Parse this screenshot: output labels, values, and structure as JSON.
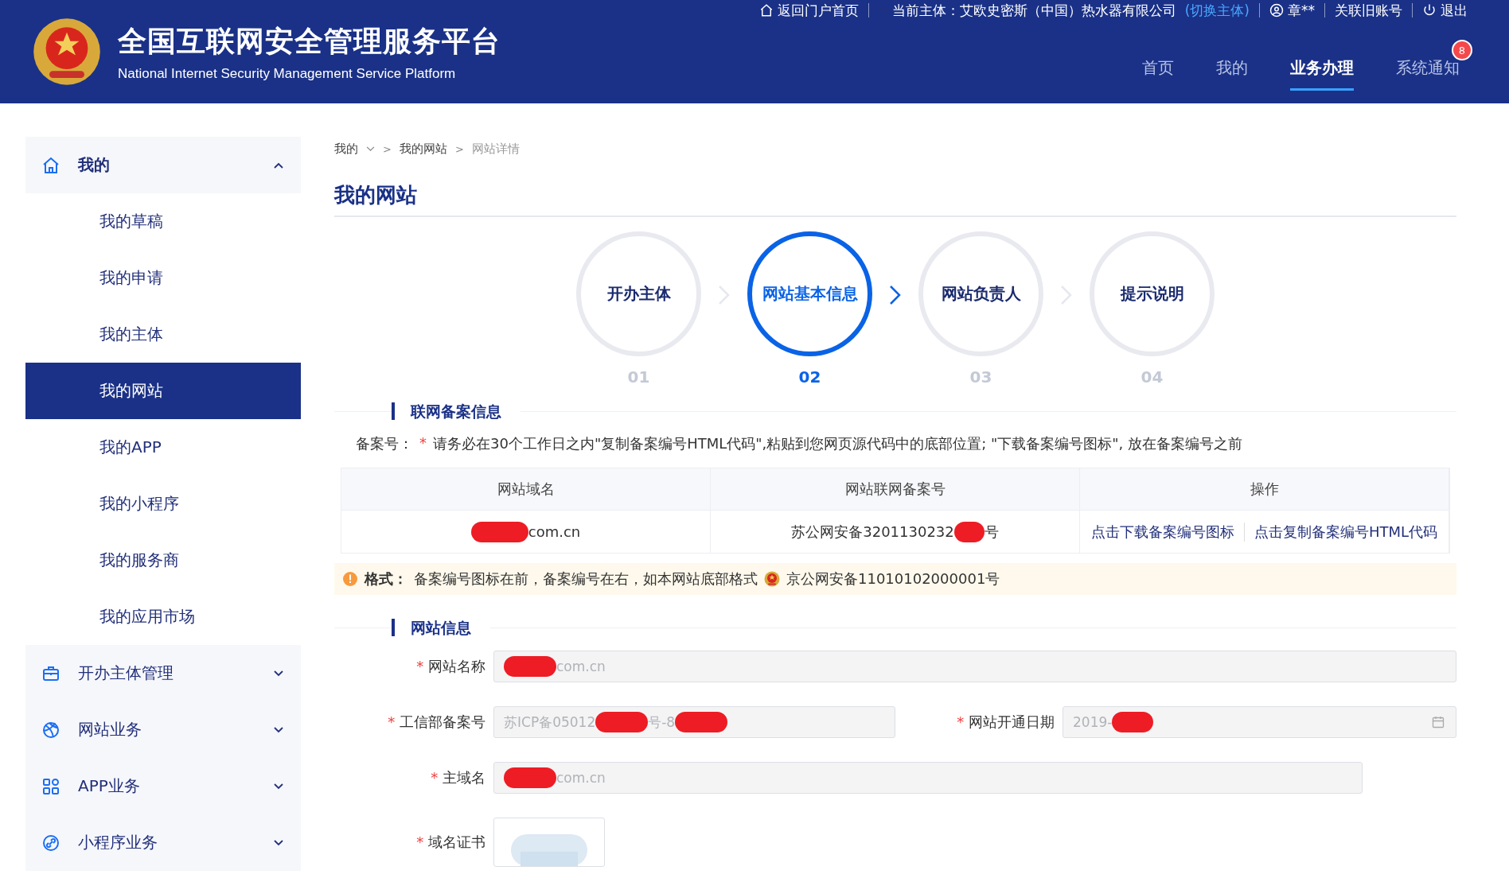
{
  "header": {
    "title": "全国互联网安全管理服务平台",
    "subtitle": "National Internet Security Management Service Platform",
    "portal_link": "返回门户首页",
    "subject_label": "当前主体：艾欧史密斯（中国）热水器有限公司",
    "switch_link": "(切换主体)",
    "user": "章**",
    "old_account_link": "关联旧账号",
    "logout": "退出",
    "nav": [
      {
        "label": "首页",
        "selected": false
      },
      {
        "label": "我的",
        "selected": false
      },
      {
        "label": "业务办理",
        "selected": true
      },
      {
        "label": "系统通知",
        "selected": false,
        "badge": "8"
      }
    ]
  },
  "sidebar": {
    "groups": [
      {
        "label": "我的",
        "expanded": true,
        "children": [
          {
            "label": "我的草稿",
            "selected": false
          },
          {
            "label": "我的申请",
            "selected": false
          },
          {
            "label": "我的主体",
            "selected": false
          },
          {
            "label": "我的网站",
            "selected": true
          },
          {
            "label": "我的APP",
            "selected": false
          },
          {
            "label": "我的小程序",
            "selected": false
          },
          {
            "label": "我的服务商",
            "selected": false
          },
          {
            "label": "我的应用市场",
            "selected": false
          }
        ]
      },
      {
        "label": "开办主体管理",
        "expanded": false
      },
      {
        "label": "网站业务",
        "expanded": false
      },
      {
        "label": "APP业务",
        "expanded": false
      },
      {
        "label": "小程序业务",
        "expanded": false
      }
    ]
  },
  "breadcrumb": [
    {
      "kind": "link",
      "text": "我的"
    },
    {
      "kind": "separator",
      "text": ">"
    },
    {
      "kind": "link",
      "text": "我的网站"
    },
    {
      "kind": "separator",
      "text": ">"
    },
    {
      "kind": "current",
      "text": "网站详情"
    }
  ],
  "page_title": "我的网站",
  "steps": [
    {
      "label": "开办主体",
      "number": "01",
      "selected": false
    },
    {
      "label": "网站基本信息",
      "number": "02",
      "selected": true
    },
    {
      "label": "网站负责人",
      "number": "03",
      "selected": false
    },
    {
      "label": "提示说明",
      "number": "04",
      "selected": false
    }
  ],
  "record_section": {
    "title": "联网备案信息",
    "notice_label": "备案号：",
    "notice_required": "*",
    "notice": "请务必在30个工作日之内\"复制备案编号HTML代码\",粘贴到您网页源代码中的底部位置; \"下载备案编号图标\", 放在备案编号之前",
    "table": {
      "columns": [
        "网站域名",
        "网站联网备案号",
        "操作"
      ],
      "rows": [
        {
          "domain_parts": [
            {
              "kind": "redaction"
            },
            {
              "kind": "text",
              "text": "com.cn"
            }
          ],
          "record_parts": [
            {
              "kind": "text",
              "text": "苏公网安备3201130232"
            },
            {
              "kind": "redaction"
            },
            {
              "kind": "text",
              "text": "号"
            }
          ],
          "actions": [
            "点击下载备案编号图标",
            "点击复制备案编号HTML代码"
          ]
        }
      ]
    },
    "tip": {
      "label": "格式：",
      "text": "备案编号图标在前，备案编号在右，如本网站底部格式",
      "example": "京公网安备11010102000001号"
    }
  },
  "site_section": {
    "title": "网站信息",
    "rows": [
      [
        {
          "label": "网站名称",
          "required": true,
          "kind": "text",
          "value_parts": [
            {
              "kind": "redaction"
            },
            {
              "kind": "text",
              "text": "com.cn"
            }
          ]
        }
      ],
      [
        {
          "label": "工信部备案号",
          "required": true,
          "kind": "text",
          "value_parts": [
            {
              "kind": "text",
              "text": "苏ICP备05012"
            },
            {
              "kind": "redaction"
            },
            {
              "kind": "text",
              "text": "号-8"
            },
            {
              "kind": "redaction"
            }
          ]
        },
        {
          "label": "网站开通日期",
          "required": true,
          "kind": "date",
          "value_parts": [
            {
              "kind": "text",
              "text": "2019-"
            },
            {
              "kind": "redaction"
            }
          ]
        }
      ],
      [
        {
          "label": "主域名",
          "required": true,
          "kind": "text",
          "value_parts": [
            {
              "kind": "redaction"
            },
            {
              "kind": "text",
              "text": "com.cn"
            }
          ]
        }
      ],
      [
        {
          "label": "域名证书",
          "required": true
        }
      ]
    ]
  }
}
